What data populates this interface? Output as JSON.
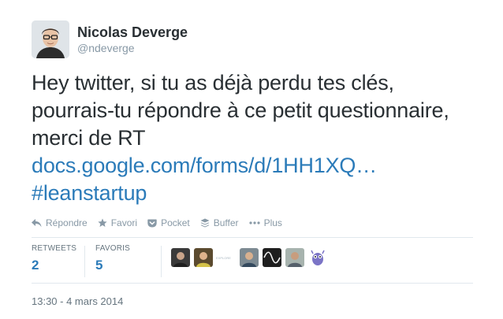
{
  "author": {
    "fullname": "Nicolas Deverge",
    "username": "@ndeverge"
  },
  "tweet": {
    "lines": [
      "Hey twitter, si tu as déjà perdu tes clés,",
      "pourrais-tu répondre à ce petit questionnaire,",
      "merci de RT"
    ],
    "link": "docs.google.com/forms/d/1HH1XQ…",
    "hashtag": "#leanstartup"
  },
  "actions": {
    "reply": "Répondre",
    "favorite": "Favori",
    "pocket": "Pocket",
    "buffer": "Buffer",
    "more": "Plus"
  },
  "stats": {
    "retweets_label": "RETWEETS",
    "retweets_count": "2",
    "favorites_label": "FAVORIS",
    "favorites_count": "5"
  },
  "faces": {
    "tiny_text": "EXPLORE"
  },
  "timestamp": "13:30 - 4 mars 2014",
  "colors": {
    "link": "#2b7bb9",
    "muted": "#8899a6",
    "text": "#292f33"
  }
}
